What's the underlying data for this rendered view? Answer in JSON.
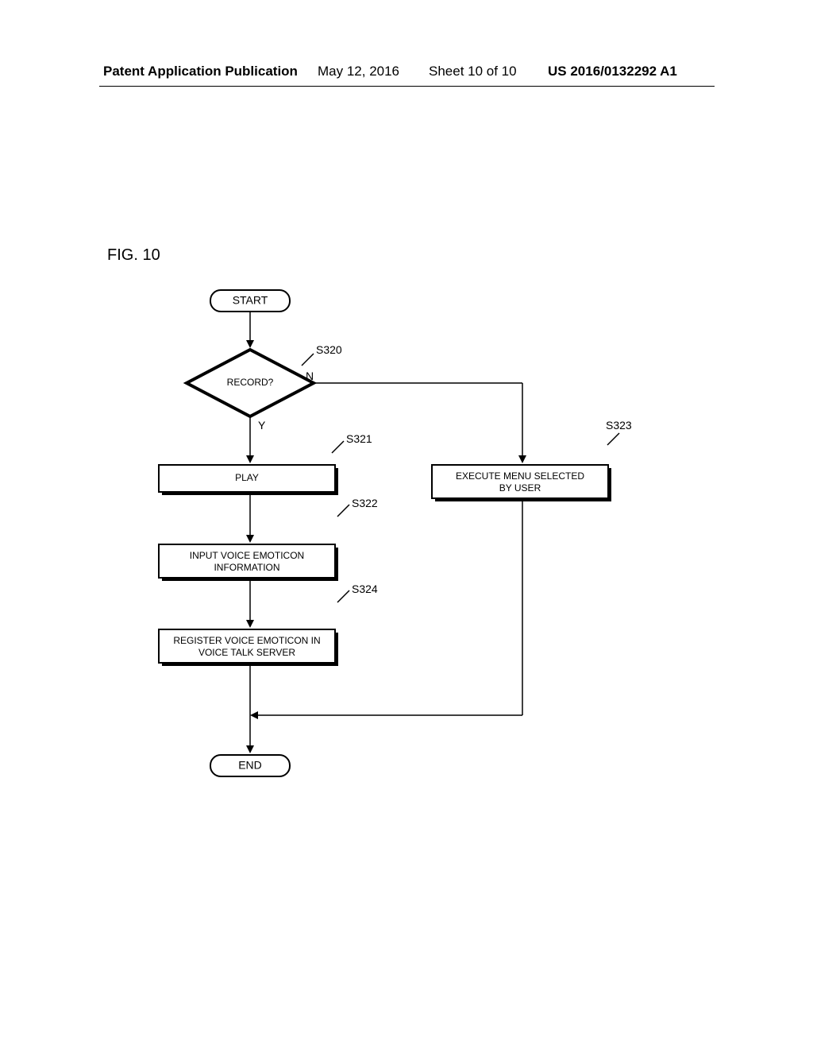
{
  "header": {
    "publication": "Patent Application Publication",
    "date": "May 12, 2016",
    "sheet": "Sheet 10 of 10",
    "pubnum": "US 2016/0132292 A1"
  },
  "figure": {
    "label": "FIG. 10"
  },
  "chart_data": {
    "type": "flowchart",
    "nodes": [
      {
        "id": "start",
        "kind": "terminator",
        "text": "START"
      },
      {
        "id": "decision",
        "kind": "decision",
        "text": "RECORD?",
        "step": "S320",
        "yes_label": "Y",
        "no_label": "N"
      },
      {
        "id": "play",
        "kind": "process",
        "text": "PLAY",
        "step": "S321"
      },
      {
        "id": "input",
        "kind": "process",
        "text": "INPUT VOICE EMOTICON INFORMATION",
        "step": "S322"
      },
      {
        "id": "register",
        "kind": "process",
        "text": "REGISTER VOICE EMOTICON IN VOICE TALK SERVER",
        "step": "S324"
      },
      {
        "id": "execute",
        "kind": "process",
        "text": "EXECUTE MENU SELECTED BY USER",
        "step": "S323"
      },
      {
        "id": "end",
        "kind": "terminator",
        "text": "END"
      }
    ],
    "edges": [
      {
        "from": "start",
        "to": "decision"
      },
      {
        "from": "decision",
        "to": "play",
        "label": "Y"
      },
      {
        "from": "decision",
        "to": "execute",
        "label": "N"
      },
      {
        "from": "play",
        "to": "input"
      },
      {
        "from": "input",
        "to": "register"
      },
      {
        "from": "register",
        "to": "end"
      },
      {
        "from": "execute",
        "to": "end"
      }
    ]
  },
  "labels": {
    "start": "START",
    "record": "RECORD?",
    "play": "PLAY",
    "input_l1": "INPUT VOICE EMOTICON",
    "input_l2": "INFORMATION",
    "register_l1": "REGISTER VOICE EMOTICON IN",
    "register_l2": "VOICE TALK SERVER",
    "execute_l1": "EXECUTE MENU SELECTED",
    "execute_l2": "BY USER",
    "end": "END",
    "s320": "S320",
    "s321": "S321",
    "s322": "S322",
    "s323": "S323",
    "s324": "S324",
    "y": "Y",
    "n": "N"
  }
}
